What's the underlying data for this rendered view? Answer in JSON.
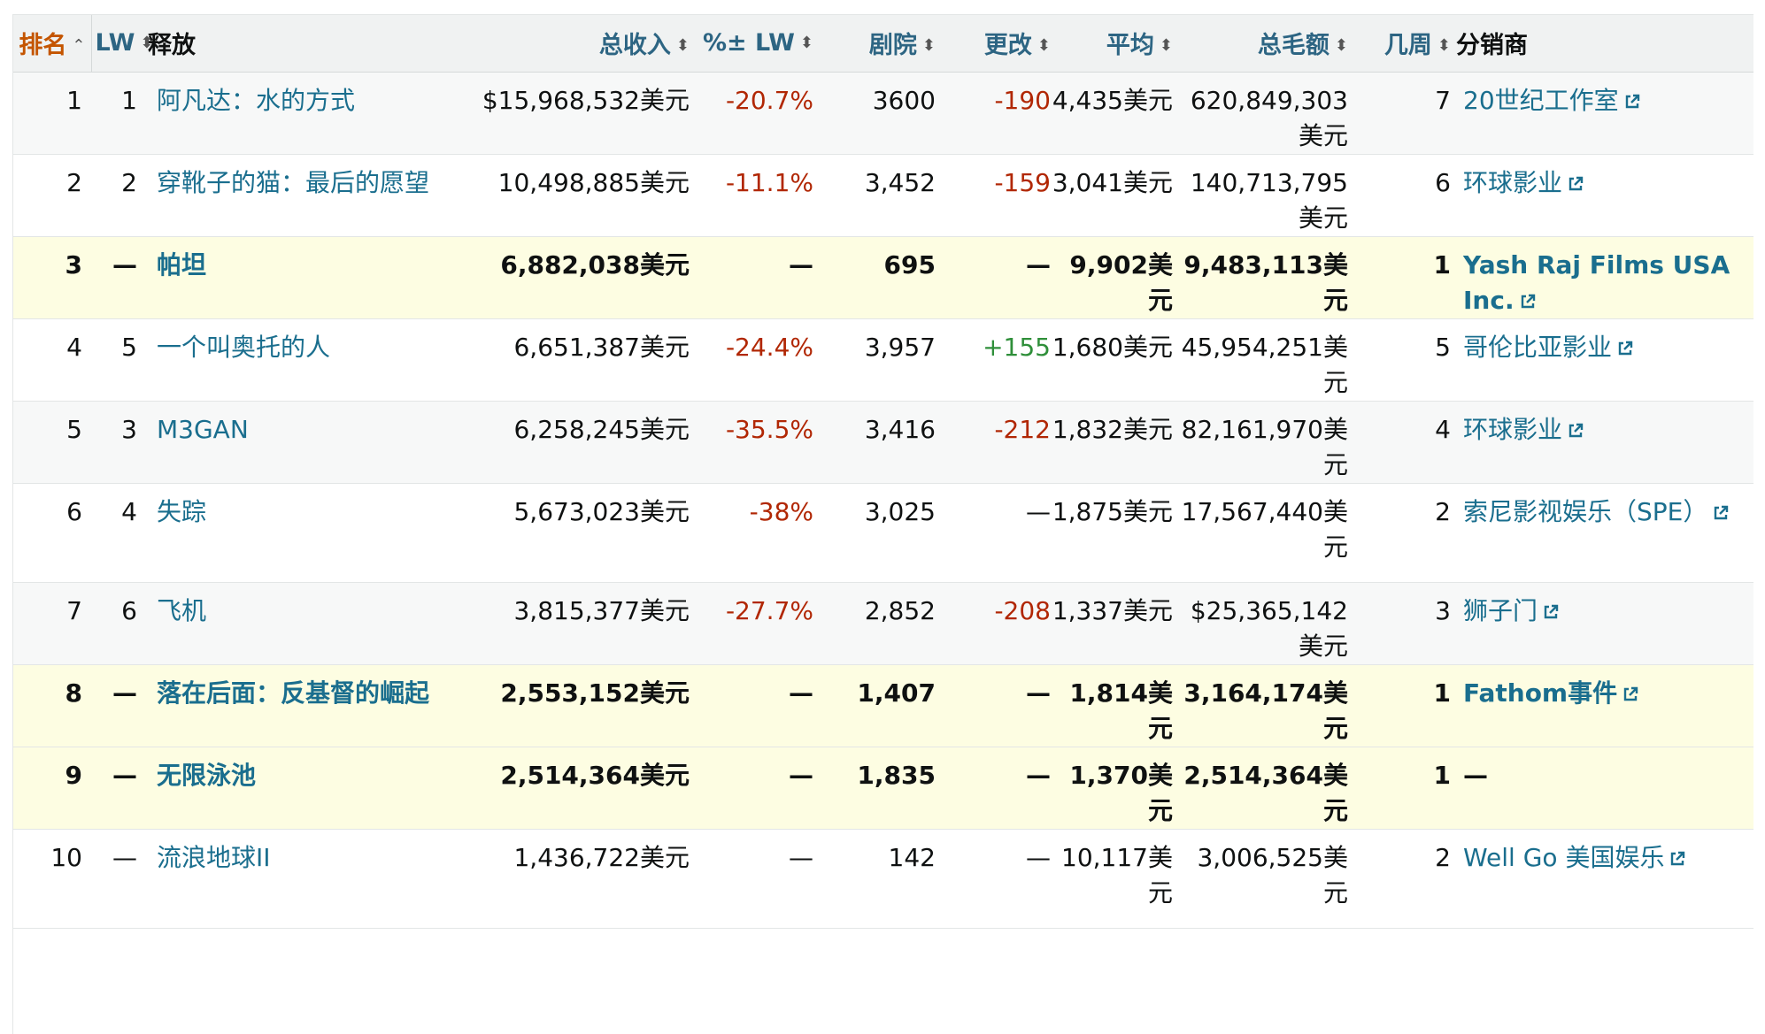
{
  "headers": {
    "rank": "排名",
    "lw": "LW",
    "release": "释放",
    "gross": "总收入",
    "pct_lw": "%± LW",
    "theaters": "剧院",
    "change": "更改",
    "average": "平均",
    "total_gross": "总毛额",
    "weeks": "几周",
    "distributor": "分销商"
  },
  "icons": {
    "sort_asc": "caret-up-icon",
    "sort_both": "sort-icon",
    "external": "external-link-icon"
  },
  "colors": {
    "link": "#1a6e8e",
    "negative": "#b12704",
    "positive": "#2f8f3a",
    "new_row": "#fdfde2"
  },
  "rows": [
    {
      "rank": "1",
      "lw": "1",
      "release": "阿凡达：水的方式",
      "gross": "$15,968,532美元",
      "pct": "-20.7%",
      "theaters": "3600",
      "change": "-190",
      "avg": "4,435美元",
      "total": "620,849,303美元",
      "weeks": "7",
      "dist": "20世纪工作室"
    },
    {
      "rank": "2",
      "lw": "2",
      "release": "穿靴子的猫：最后的愿望",
      "gross": "10,498,885美元",
      "pct": "-11.1%",
      "theaters": "3,452",
      "change": "-159",
      "avg": "3,041美元",
      "total": "140,713,795美元",
      "weeks": "6",
      "dist": "环球影业"
    },
    {
      "rank": "3",
      "lw": "—",
      "release": "帕坦",
      "gross": "6,882,038美元",
      "pct": "—",
      "theaters": "695",
      "change": "—",
      "avg": "9,902美元",
      "total": "9,483,113美元",
      "weeks": "1",
      "dist": "Yash Raj Films USA Inc."
    },
    {
      "rank": "4",
      "lw": "5",
      "release": "一个叫奥托的人",
      "gross": "6,651,387美元",
      "pct": "-24.4%",
      "theaters": "3,957",
      "change": "+155",
      "avg": "1,680美元",
      "total": "45,954,251美元",
      "weeks": "5",
      "dist": "哥伦比亚影业"
    },
    {
      "rank": "5",
      "lw": "3",
      "release": "M3GAN",
      "gross": "6,258,245美元",
      "pct": "-35.5%",
      "theaters": "3,416",
      "change": "-212",
      "avg": "1,832美元",
      "total": "82,161,970美元",
      "weeks": "4",
      "dist": "环球影业"
    },
    {
      "rank": "6",
      "lw": "4",
      "release": "失踪",
      "gross": "5,673,023美元",
      "pct": "-38%",
      "theaters": "3,025",
      "change": "—",
      "avg": "1,875美元",
      "total": "17,567,440美元",
      "weeks": "2",
      "dist": "索尼影视娱乐（SPE）"
    },
    {
      "rank": "7",
      "lw": "6",
      "release": "飞机",
      "gross": "3,815,377美元",
      "pct": "-27.7%",
      "theaters": "2,852",
      "change": "-208",
      "avg": "1,337美元",
      "total": "$25,365,142美元",
      "weeks": "3",
      "dist": "狮子门"
    },
    {
      "rank": "8",
      "lw": "—",
      "release": "落在后面：反基督的崛起",
      "gross": "2,553,152美元",
      "pct": "—",
      "theaters": "1,407",
      "change": "—",
      "avg": "1,814美元",
      "total": "3,164,174美元",
      "weeks": "1",
      "dist": "Fathom事件"
    },
    {
      "rank": "9",
      "lw": "—",
      "release": "无限泳池",
      "gross": "2,514,364美元",
      "pct": "—",
      "theaters": "1,835",
      "change": "—",
      "avg": "1,370美元",
      "total": "2,514,364美元",
      "weeks": "1",
      "dist": "—"
    },
    {
      "rank": "10",
      "lw": "—",
      "release": "流浪地球II",
      "gross": "1,436,722美元",
      "pct": "—",
      "theaters": "142",
      "change": "—",
      "avg": "10,117美元",
      "total": "3,006,525美元",
      "weeks": "2",
      "dist": "Well Go 美国娱乐"
    }
  ]
}
